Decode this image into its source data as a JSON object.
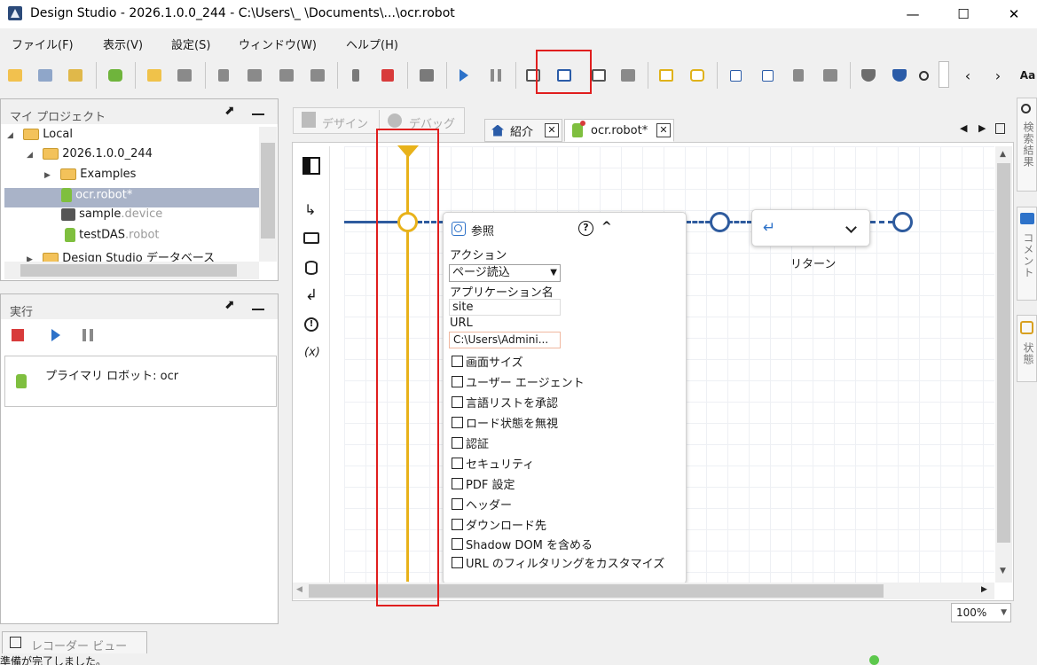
{
  "window": {
    "title": "Design Studio - 2026.1.0.0_244 - C:\\Users\\_      \\Documents\\...\\ocr.robot",
    "minimize": "—",
    "maximize": "☐",
    "close": "✕"
  },
  "menu": [
    "ファイル(F)",
    "表示(V)",
    "設定(S)",
    "ウィンドウ(W)",
    "ヘルプ(H)"
  ],
  "toolbar": {
    "font_button": "Aa"
  },
  "project_panel": {
    "title": "マイ プロジェクト",
    "tree": [
      {
        "label": "Local",
        "suffix": ""
      },
      {
        "label": "2026.1.0.0_244",
        "suffix": ""
      },
      {
        "label": "Examples",
        "suffix": ""
      },
      {
        "label": "ocr.robot*",
        "suffix": ""
      },
      {
        "label": "sample",
        "suffix": ".device"
      },
      {
        "label": "testDAS",
        "suffix": ".robot"
      },
      {
        "label": "Design Studio データベース",
        "suffix": ""
      }
    ]
  },
  "run_panel": {
    "title": "実行",
    "primary_robot": "プライマリ ロボット: ocr"
  },
  "mode_tabs": {
    "design": "デザイン",
    "debug": "デバッグ"
  },
  "editor_tabs": [
    {
      "label": "紹介"
    },
    {
      "label": "ocr.robot*"
    }
  ],
  "step_browse": {
    "title": "参照",
    "help": "?",
    "collapse": "^",
    "action_label": "アクション",
    "action_value": "ページ読込",
    "app_name_label": "アプリケーション名",
    "app_name_value": "site",
    "url_label": "URL",
    "url_value": "C:\\Users\\Admini...",
    "options": [
      "画面サイズ",
      "ユーザー エージェント",
      "言語リストを承認",
      "ロード状態を無視",
      "認証",
      "セキュリティ",
      "PDF 設定",
      "ヘッダー",
      "ダウンロード先",
      "Shadow DOM を含める",
      "URL のフィルタリングをカスタマイズ"
    ]
  },
  "step_return": {
    "icon": "↵",
    "label": "リターン"
  },
  "side_tabs": {
    "search": "検索結果",
    "comment": "コメント",
    "state": "状態"
  },
  "zoom": {
    "value": "100%"
  },
  "bottom_tab": {
    "label": "レコーダー ビュー"
  },
  "status": {
    "text": "準備が完了しました。"
  },
  "colors": {
    "accent": "#2b5ca8",
    "flow_line": "#2e5b9e",
    "cursor": "#e8b21a",
    "highlight": "#e01e1e",
    "selection": "#a9b3c8"
  }
}
